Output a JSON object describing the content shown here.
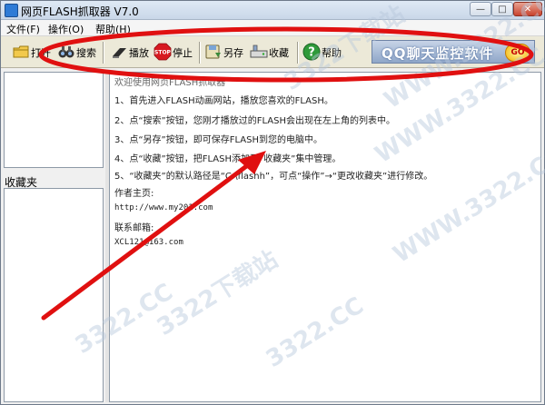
{
  "window": {
    "title": "网页FLASH抓取器 V7.0"
  },
  "menu": [
    {
      "label": "文件(F)"
    },
    {
      "label": "操作(O)"
    },
    {
      "label": "帮助(H)"
    }
  ],
  "toolbar": {
    "open": "打开",
    "search": "搜索",
    "play": "播放",
    "stop": "停止",
    "save_as": "另存",
    "favorite": "收藏",
    "help": "帮助",
    "stop_icon_text": "STOP"
  },
  "banner": {
    "text": "QQ聊天监控软件",
    "go": "GO"
  },
  "sidebar": {
    "favorites_label": "收藏夹"
  },
  "content": {
    "lines": [
      "欢迎使用网页FLASH抓取器",
      "1、首先进入FLASH动画网站，播放您喜欢的FLASH。",
      "2、点“搜索”按钮，您刚才播放过的FLASH会出现在左上角的列表中。",
      "3、点“另存”按钮，即可保存FLASH到您的电脑中。",
      "4、点“收藏”按钮，把FLASH添加到“收藏夹”集中管理。",
      "5、“收藏夹”的默认路径是“C:\\flashh”，可点“操作”→“更改收藏夹”进行修改。",
      "作者主页:",
      "http://www.my201.com",
      "联系邮箱:",
      "XCL121@163.com"
    ]
  },
  "watermark": {
    "text": "3322.CC",
    "text_cn": "3322下载站",
    "text_www": "WWW.3322.CC"
  },
  "colors": {
    "annotation_red": "#e01010",
    "watermark": "#b8c8dc"
  }
}
